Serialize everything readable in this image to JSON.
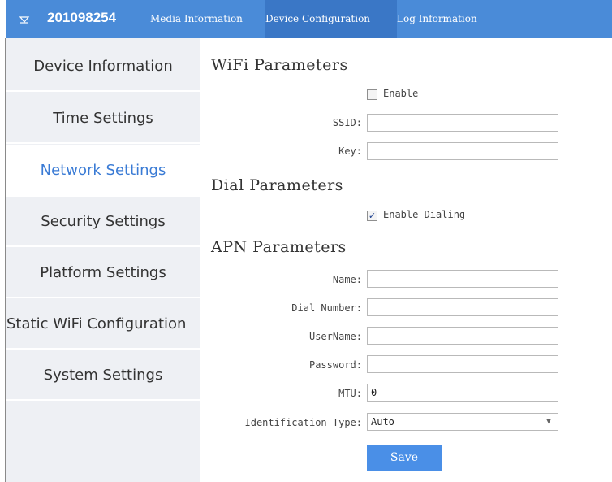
{
  "header": {
    "device_id": "201098254",
    "tabs": [
      {
        "label": "Media Information",
        "active": false
      },
      {
        "label": "Device Configuration",
        "active": true
      },
      {
        "label": "Log Information",
        "active": false
      }
    ]
  },
  "sidebar": {
    "items": [
      {
        "label": "Device Information",
        "active": false
      },
      {
        "label": "Time Settings",
        "active": false
      },
      {
        "label": "Network Settings",
        "active": true
      },
      {
        "label": "Security Settings",
        "active": false
      },
      {
        "label": "Platform Settings",
        "active": false
      },
      {
        "label": "Static WiFi Configuration",
        "active": false
      },
      {
        "label": "System Settings",
        "active": false
      }
    ]
  },
  "wifi": {
    "title": "WiFi Parameters",
    "enable_label": "Enable",
    "enable_checked": false,
    "ssid_label": "SSID:",
    "ssid_value": "",
    "key_label": "Key:",
    "key_value": ""
  },
  "dial": {
    "title": "Dial Parameters",
    "enable_label": "Enable Dialing",
    "enable_checked": true
  },
  "apn": {
    "title": "APN Parameters",
    "name_label": "Name:",
    "name_value": "",
    "dial_number_label": "Dial Number:",
    "dial_number_value": "",
    "username_label": "UserName:",
    "username_value": "",
    "password_label": "Password:",
    "password_value": "",
    "mtu_label": "MTU:",
    "mtu_value": "0",
    "id_type_label": "Identification Type:",
    "id_type_value": "Auto"
  },
  "actions": {
    "save_label": "Save"
  },
  "colors": {
    "header_bg": "#4a8bd8",
    "active_tab_bg": "#3a77c6",
    "sidebar_bg": "#eef0f4",
    "active_sidebar_text": "#3a7bd5",
    "save_button_bg": "#4a8fe7"
  }
}
